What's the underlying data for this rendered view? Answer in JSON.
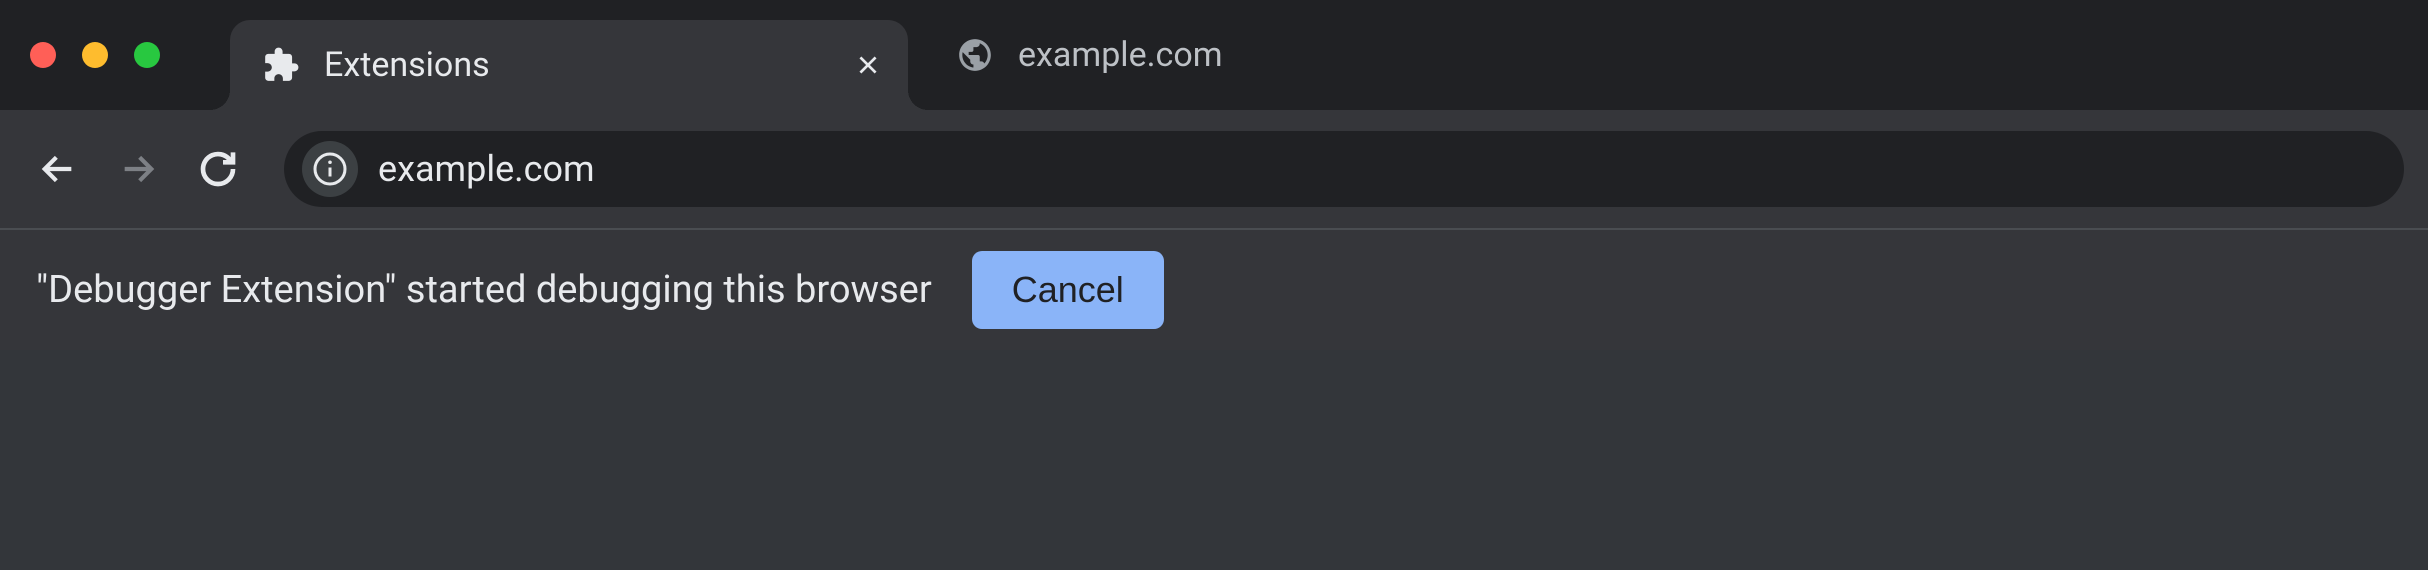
{
  "tabs": [
    {
      "title": "Extensions",
      "icon": "extension-icon",
      "active": true
    },
    {
      "title": "example.com",
      "icon": "globe-icon",
      "active": false
    }
  ],
  "omnibox": {
    "url": "example.com"
  },
  "infobar": {
    "message": "\"Debugger Extension\" started debugging this browser",
    "cancel_label": "Cancel"
  }
}
